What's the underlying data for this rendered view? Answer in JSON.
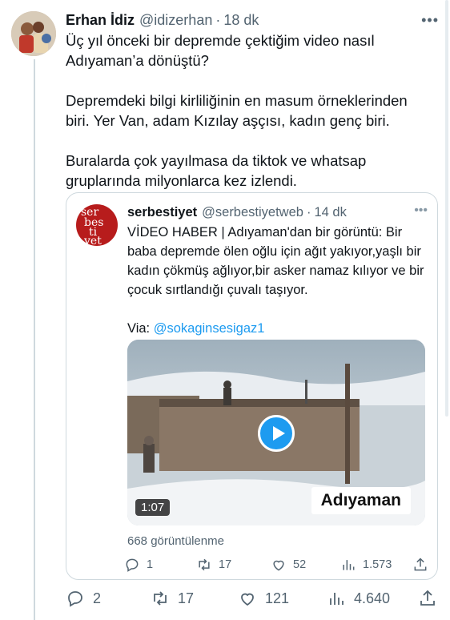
{
  "tweet": {
    "author_name": "Erhan İdiz",
    "handle": "@idizerhan",
    "separator": "·",
    "time": "18 dk",
    "more": "•••",
    "paragraphs": [
      "Üç yıl önceki bir depremde çektiğim video nasıl Adıyaman’a dönüştü?",
      "Depremdeki bilgi kirliliğinin en masum örneklerinden biri. Yer Van, adam Kızılay aşçısı, kadın genç biri.",
      "Buralarda çok yayılmasa da tiktok ve whatsap gruplarında milyonlarca kez izlendi."
    ],
    "actions": {
      "replies": "2",
      "retweets": "17",
      "likes": "121",
      "views": "4.640"
    }
  },
  "quote": {
    "avatar_text": [
      "ser",
      "bes",
      "ti",
      "yet"
    ],
    "author_name": "serbestiyet",
    "handle": "@serbestiyetweb",
    "separator": "·",
    "time": "14 dk",
    "more": "•••",
    "text": "VİDEO HABER | Adıyaman'dan bir görüntü: Bir baba depremde ölen oğlu için ağıt yakıyor,yaşlı bir kadın çökmüş ağlıyor,bir asker namaz kılıyor ve bir çocuk sırtlandığı çuvalı taşıyor.",
    "via_label": "Via: ",
    "via_link": "@sokaginsesigaz1",
    "video": {
      "duration": "1:07",
      "overlay_label": "Adıyaman"
    },
    "views": "668 görüntülenme",
    "actions": {
      "replies": "1",
      "retweets": "17",
      "likes": "52",
      "views": "1.573"
    }
  },
  "colors": {
    "accent": "#1d9bf0",
    "muted": "#536471",
    "border": "#cfd9de",
    "brand": "#b71c1c"
  },
  "icons": [
    "reply-icon",
    "retweet-icon",
    "like-icon",
    "views-icon",
    "share-icon",
    "play-icon"
  ]
}
